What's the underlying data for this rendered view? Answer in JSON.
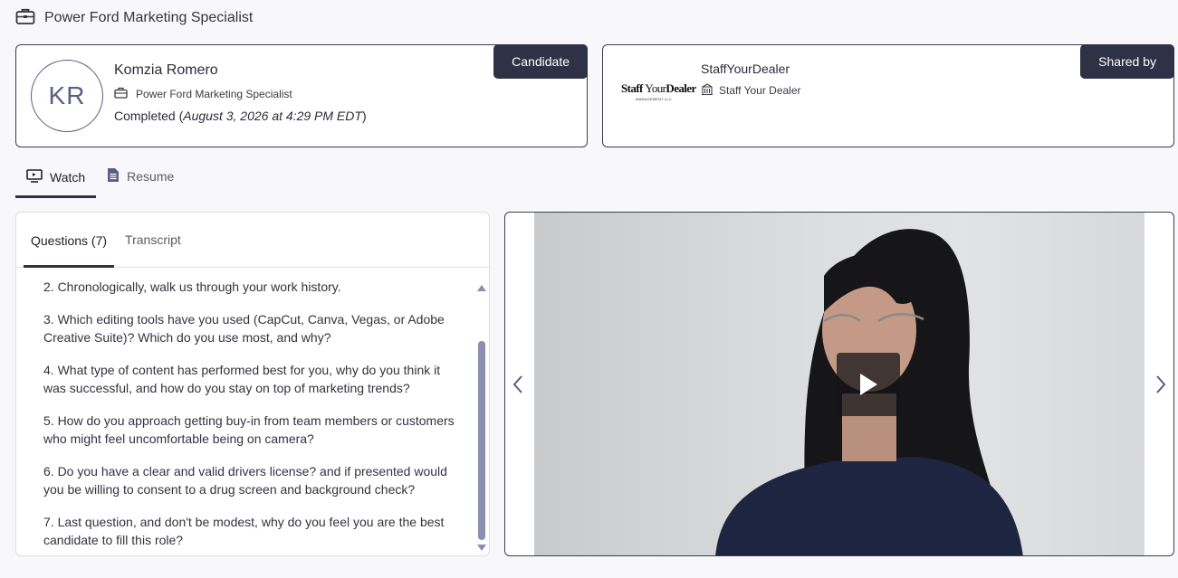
{
  "header": {
    "title": "Power Ford Marketing Specialist",
    "icon": "briefcase-icon"
  },
  "candidate_card": {
    "tag": "Candidate",
    "initials": "KR",
    "name": "Komzia Romero",
    "role": "Power Ford Marketing Specialist",
    "status": "Completed",
    "date": "August 3, 2026 at 4:29 PM EDT"
  },
  "shared_card": {
    "tag": "Shared by",
    "logo_line1a": "Staff ",
    "logo_line1b": "Your",
    "logo_line1c": "Dealer",
    "logo_line2": "MANAGEMENT LLC",
    "name": "StaffYourDealer",
    "org": "Staff Your Dealer"
  },
  "main_tabs": [
    {
      "label": "Watch",
      "icon": "monitor-icon",
      "active": true
    },
    {
      "label": "Resume",
      "icon": "document-icon",
      "active": false
    }
  ],
  "panel_tabs": [
    {
      "label": "Questions (7)",
      "active": true
    },
    {
      "label": "Transcript",
      "active": false
    }
  ],
  "questions": [
    "2. Chronologically, walk us through your work history.",
    "3. Which editing tools have you used (CapCut, Canva, Vegas, or Adobe Creative Suite)? Which do you use most, and why?",
    "4. What type of content has performed best for you, why do you think it was successful, and how do you stay on top of marketing trends?",
    "5. How do you approach getting buy-in from team members or customers who might feel uncomfortable being on camera?",
    "6. Do you have a clear and valid drivers license? and if presented would you be willing to consent to a drug screen and background check?",
    "7. Last question, and don't be modest, why do you feel you are the best candidate to fill this role?"
  ],
  "colors": {
    "accent": "#2f3246",
    "scrollbar": "#8a8fb0",
    "avatar": "#5a5e84"
  }
}
